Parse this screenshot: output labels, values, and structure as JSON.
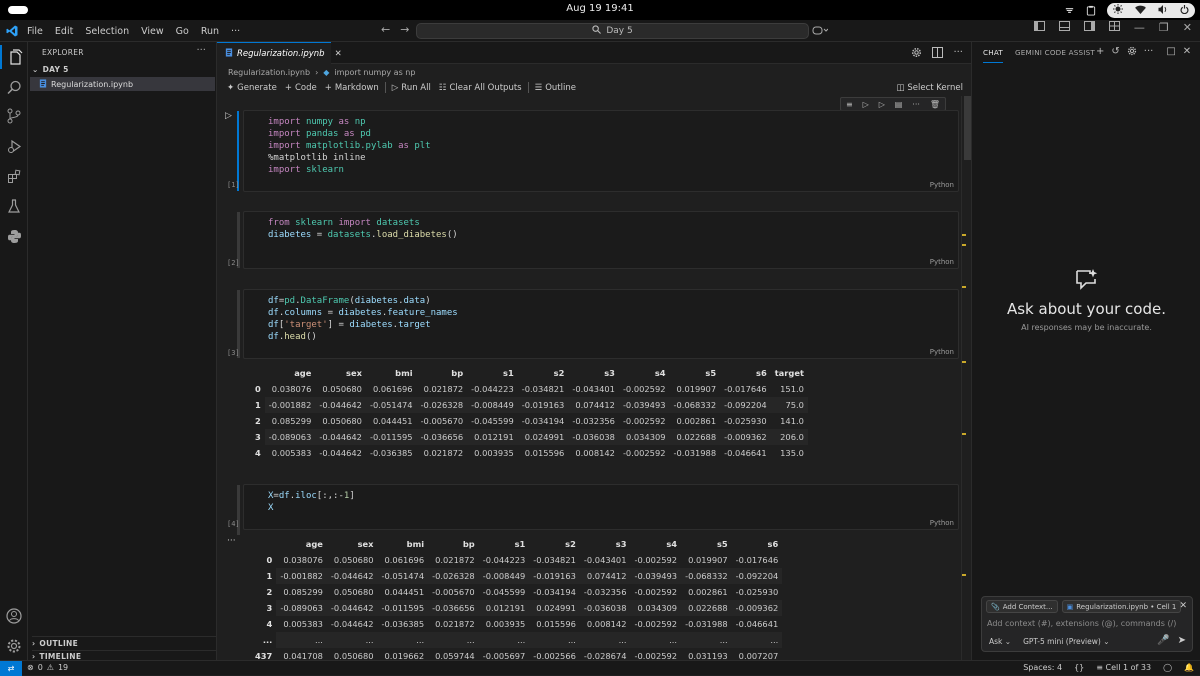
{
  "system": {
    "clock": "Aug 19  19:41"
  },
  "menus": [
    "File",
    "Edit",
    "Selection",
    "View",
    "Go",
    "Run",
    "···"
  ],
  "command_center": {
    "text": "Day 5"
  },
  "sidebar": {
    "title": "EXPLORER",
    "folder": "DAY 5",
    "file": "Regularization.ipynb",
    "outline": "OUTLINE",
    "timeline": "TIMELINE"
  },
  "editor": {
    "tab": "Regularization.ipynb",
    "breadcrumb": [
      "Regularization.ipynb",
      "import numpy as np"
    ],
    "toolbar": {
      "generate": "Generate",
      "code": "Code",
      "markdown": "Markdown",
      "run_all": "Run All",
      "clear_outputs": "Clear All Outputs",
      "outline": "Outline",
      "select_kernel": "Select Kernel"
    },
    "cells": [
      {
        "count": "[1]",
        "lang": "Python"
      },
      {
        "count": "[2]",
        "lang": "Python"
      },
      {
        "count": "[3]",
        "lang": "Python"
      },
      {
        "count": "[4]",
        "lang": "Python"
      }
    ],
    "output_more": "···"
  },
  "table1": {
    "columns": [
      "",
      "age",
      "sex",
      "bmi",
      "bp",
      "s1",
      "s2",
      "s3",
      "s4",
      "s5",
      "s6",
      "target"
    ],
    "rows": [
      [
        "0",
        "0.038076",
        "0.050680",
        "0.061696",
        "0.021872",
        "-0.044223",
        "-0.034821",
        "-0.043401",
        "-0.002592",
        "0.019907",
        "-0.017646",
        "151.0"
      ],
      [
        "1",
        "-0.001882",
        "-0.044642",
        "-0.051474",
        "-0.026328",
        "-0.008449",
        "-0.019163",
        "0.074412",
        "-0.039493",
        "-0.068332",
        "-0.092204",
        "75.0"
      ],
      [
        "2",
        "0.085299",
        "0.050680",
        "0.044451",
        "-0.005670",
        "-0.045599",
        "-0.034194",
        "-0.032356",
        "-0.002592",
        "0.002861",
        "-0.025930",
        "141.0"
      ],
      [
        "3",
        "-0.089063",
        "-0.044642",
        "-0.011595",
        "-0.036656",
        "0.012191",
        "0.024991",
        "-0.036038",
        "0.034309",
        "0.022688",
        "-0.009362",
        "206.0"
      ],
      [
        "4",
        "0.005383",
        "-0.044642",
        "-0.036385",
        "0.021872",
        "0.003935",
        "0.015596",
        "0.008142",
        "-0.002592",
        "-0.031988",
        "-0.046641",
        "135.0"
      ]
    ]
  },
  "table2": {
    "columns": [
      "",
      "age",
      "sex",
      "bmi",
      "bp",
      "s1",
      "s2",
      "s3",
      "s4",
      "s5",
      "s6"
    ],
    "rows": [
      [
        "0",
        "0.038076",
        "0.050680",
        "0.061696",
        "0.021872",
        "-0.044223",
        "-0.034821",
        "-0.043401",
        "-0.002592",
        "0.019907",
        "-0.017646"
      ],
      [
        "1",
        "-0.001882",
        "-0.044642",
        "-0.051474",
        "-0.026328",
        "-0.008449",
        "-0.019163",
        "0.074412",
        "-0.039493",
        "-0.068332",
        "-0.092204"
      ],
      [
        "2",
        "0.085299",
        "0.050680",
        "0.044451",
        "-0.005670",
        "-0.045599",
        "-0.034194",
        "-0.032356",
        "-0.002592",
        "0.002861",
        "-0.025930"
      ],
      [
        "3",
        "-0.089063",
        "-0.044642",
        "-0.011595",
        "-0.036656",
        "0.012191",
        "0.024991",
        "-0.036038",
        "0.034309",
        "0.022688",
        "-0.009362"
      ],
      [
        "4",
        "0.005383",
        "-0.044642",
        "-0.036385",
        "0.021872",
        "0.003935",
        "0.015596",
        "0.008142",
        "-0.002592",
        "-0.031988",
        "-0.046641"
      ],
      [
        "...",
        "...",
        "...",
        "...",
        "...",
        "...",
        "...",
        "...",
        "...",
        "...",
        "..."
      ],
      [
        "437",
        "0.041708",
        "0.050680",
        "0.019662",
        "0.059744",
        "-0.005697",
        "-0.002566",
        "-0.028674",
        "-0.002592",
        "0.031193",
        "0.007207"
      ]
    ]
  },
  "chat": {
    "tab_chat": "CHAT",
    "tab_gemini": "GEMINI CODE ASSIST",
    "heading": "Ask about your code.",
    "subtext": "AI responses may be inaccurate.",
    "add_context": "Add Context...",
    "context_file": "Regularization.ipynb • Cell 1",
    "placeholder": "Add context (#), extensions (@), commands (/)",
    "mode": "Ask",
    "model": "GPT-5 mini (Preview)"
  },
  "status": {
    "errors": "0",
    "warnings": "19",
    "spaces": "Spaces: 4",
    "braces": "{}",
    "cell": "Cell 1 of 33"
  },
  "colors": {
    "accent": "#0078d4",
    "keyword": "#c586c0",
    "function": "#dcdcaa",
    "variable": "#9cdcfe",
    "string": "#ce9178"
  }
}
